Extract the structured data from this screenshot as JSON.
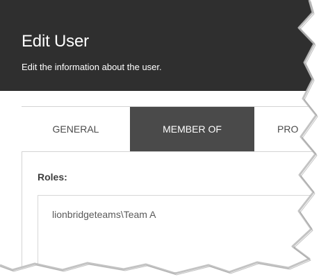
{
  "dialog": {
    "title": "Edit User",
    "subtitle": "Edit the information about the user."
  },
  "tabs": [
    {
      "label": "GENERAL",
      "active": false
    },
    {
      "label": "MEMBER OF",
      "active": true
    },
    {
      "label": "PRO",
      "active": false
    }
  ],
  "roles": {
    "label": "Roles:",
    "items": [
      "lionbridgeteams\\Team A"
    ]
  },
  "colors": {
    "header_background": "#2f2f2f",
    "active_tab_background": "#4a4a4a",
    "border": "#d3d3d3"
  }
}
